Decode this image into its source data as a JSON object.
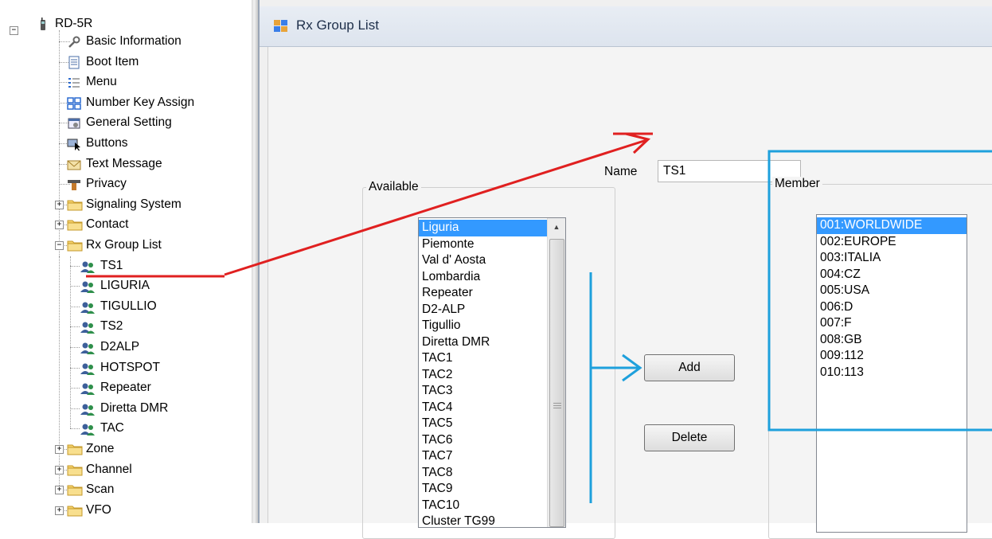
{
  "tree": {
    "root": "RD-5R",
    "items": [
      {
        "label": "Basic Information",
        "icon": "wrench-icon"
      },
      {
        "label": "Boot Item",
        "icon": "document-icon"
      },
      {
        "label": "Menu",
        "icon": "list-icon"
      },
      {
        "label": "Number Key Assign",
        "icon": "keys-icon"
      },
      {
        "label": "General Setting",
        "icon": "settings-icon"
      },
      {
        "label": "Buttons",
        "icon": "cursor-icon"
      },
      {
        "label": "Text Message",
        "icon": "envelope-icon"
      },
      {
        "label": "Privacy",
        "icon": "privacy-icon"
      },
      {
        "label": "Signaling System",
        "icon": "folder-icon"
      },
      {
        "label": "Contact",
        "icon": "folder-icon"
      },
      {
        "label": "Rx Group List",
        "icon": "folder-icon"
      },
      {
        "label": "Zone",
        "icon": "folder-icon"
      },
      {
        "label": "Channel",
        "icon": "folder-icon"
      },
      {
        "label": "Scan",
        "icon": "folder-icon"
      },
      {
        "label": "VFO",
        "icon": "folder-icon"
      }
    ],
    "rx_groups": [
      "TS1",
      "LIGURIA",
      "TIGULLIO",
      "TS2",
      "D2ALP",
      "HOTSPOT",
      "Repeater",
      "Diretta DMR",
      "TAC"
    ]
  },
  "panel": {
    "title": "Rx Group List",
    "name_label": "Name",
    "name_value": "TS1",
    "available_label": "Available",
    "member_label": "Member",
    "add_label": "Add",
    "delete_label": "Delete"
  },
  "available": [
    "Liguria",
    "Piemonte",
    "Val d' Aosta",
    "Lombardia",
    "Repeater",
    "D2-ALP",
    "Tigullio",
    "Diretta DMR",
    "TAC1",
    "TAC2",
    "TAC3",
    "TAC4",
    "TAC5",
    "TAC6",
    "TAC7",
    "TAC8",
    "TAC9",
    "TAC10",
    "Cluster TG99"
  ],
  "members": [
    "001:WORLDWIDE",
    "002:EUROPE",
    "003:ITALIA",
    "004:CZ",
    "005:USA",
    "006:D",
    "007:F",
    "008:GB",
    "009:112",
    "010:113"
  ],
  "colors": {
    "annotation_red": "#e02020",
    "annotation_blue": "#1ea0dc",
    "selection": "#3399ff"
  }
}
